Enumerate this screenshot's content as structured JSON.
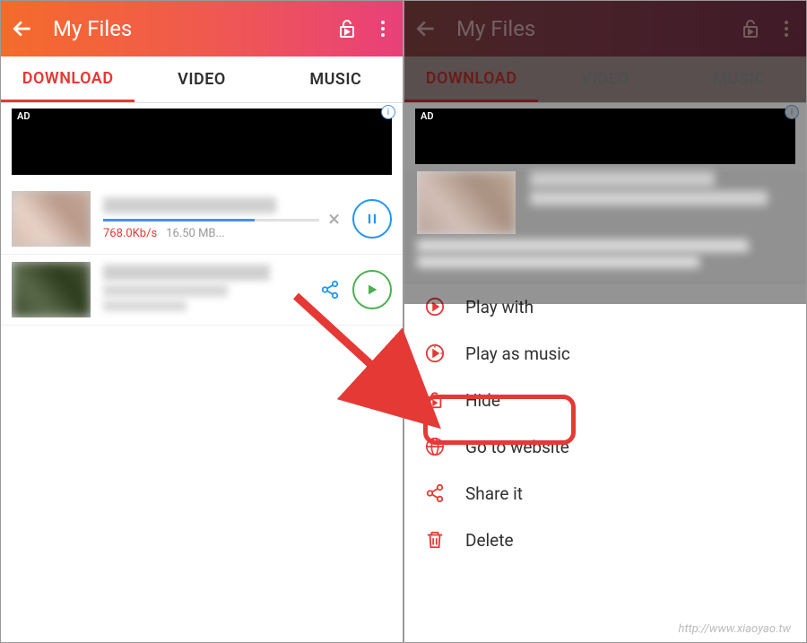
{
  "left": {
    "header_title": "My Files",
    "tabs": [
      "DOWNLOAD",
      "VIDEO",
      "MUSIC"
    ],
    "active_tab": 0,
    "ad_label": "AD",
    "download_item": {
      "speed": "768.0Kb/s",
      "size": "16.50 MB..."
    }
  },
  "right": {
    "header_title": "My Files",
    "tabs": [
      "DOWNLOAD",
      "VIDEO",
      "MUSIC"
    ],
    "active_tab": 0,
    "ad_label": "AD",
    "menu": [
      {
        "label": "Play with",
        "icon": "play-circle"
      },
      {
        "label": "Play as music",
        "icon": "play-clock"
      },
      {
        "label": "Hide",
        "icon": "lock-open"
      },
      {
        "label": "Go to website",
        "icon": "globe"
      },
      {
        "label": "Share it",
        "icon": "share"
      },
      {
        "label": "Delete",
        "icon": "trash"
      }
    ]
  },
  "highlight_menu_index": 2,
  "watermark": "http://www.xiaoyao.tw"
}
